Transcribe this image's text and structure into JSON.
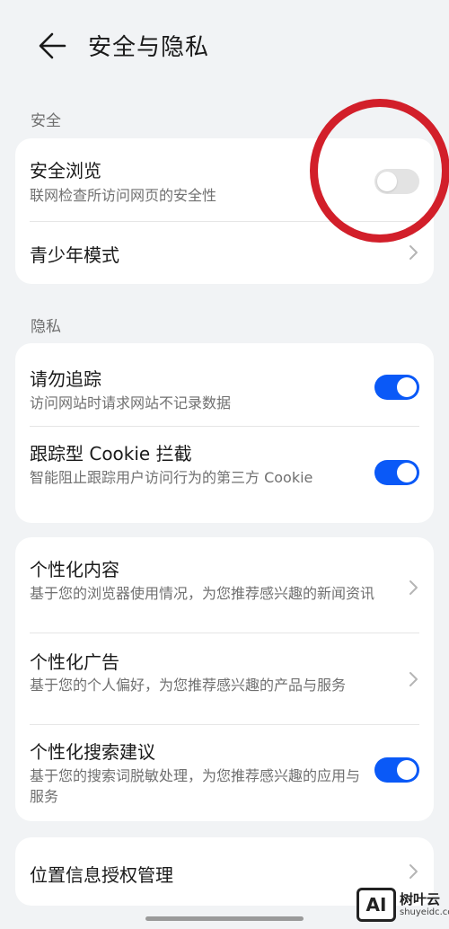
{
  "header": {
    "title": "安全与隐私"
  },
  "sections": {
    "security_label": "安全",
    "privacy_label": "隐私"
  },
  "security": {
    "safe_browsing": {
      "title": "安全浏览",
      "subtitle": "联网检查所访问网页的安全性",
      "enabled": false
    },
    "teen_mode": {
      "title": "青少年模式"
    }
  },
  "privacy": {
    "dnt": {
      "title": "请勿追踪",
      "subtitle": "访问网站时请求网站不记录数据",
      "enabled": true
    },
    "cookie_block": {
      "title": "跟踪型 Cookie 拦截",
      "subtitle": "智能阻止跟踪用户访问行为的第三方 Cookie",
      "enabled": true
    }
  },
  "personalization": {
    "content": {
      "title": "个性化内容",
      "subtitle": "基于您的浏览器使用情况，为您推荐感兴趣的新闻资讯"
    },
    "ads": {
      "title": "个性化广告",
      "subtitle": "基于您的个人偏好，为您推荐感兴趣的产品与服务"
    },
    "search": {
      "title": "个性化搜索建议",
      "subtitle": "基于您的搜索词脱敏处理，为您推荐感兴趣的应用与服务",
      "enabled": true
    }
  },
  "location": {
    "title": "位置信息授权管理"
  },
  "watermark": {
    "badge": "AI",
    "name": "树叶云",
    "sub": "shuyeidc.com"
  },
  "colors": {
    "accent": "#0a59f7",
    "annotation": "#d21f2a",
    "background": "#f1f3f5"
  }
}
